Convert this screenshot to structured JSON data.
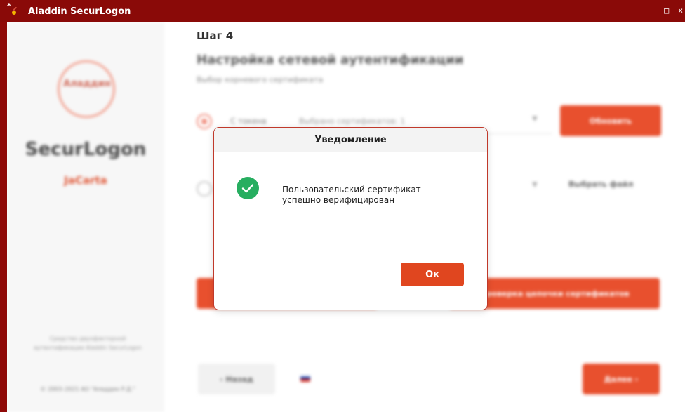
{
  "window": {
    "title": "Aladdin SecurLogon",
    "controls": {
      "minimize": "_",
      "maximize": "□",
      "close": "×"
    },
    "accent_color": "#8a0a08"
  },
  "sidebar": {
    "logo_text": "Аладдин",
    "brand": "SecurLogon",
    "brand_sub": "JaCarta",
    "note": "Средство двухфакторной аутентификации Aladdin SecurLogon",
    "copyright": "© 2003–2021 АО \"Аладдин Р.Д.\""
  },
  "main": {
    "step_label": "Шаг 4",
    "heading": "Настройка сетевой аутентификации",
    "subheading": "Выбор корневого сертификата",
    "option1_label": "С токена",
    "option1_select_value": "Выбрано сертификатов: 1",
    "update_button": "Обновить",
    "choose_file_button": "Выбрать файл",
    "chain_button": "Проверка цепочки сертификатов",
    "back_button": "‹  Назад",
    "next_button": "Далее  ›"
  },
  "dialog": {
    "title": "Уведомление",
    "message_line1": "Пользовательский сертификат",
    "message_line2": "успешно верифицирован",
    "ok_button": "Ок",
    "icon": "success-check-icon",
    "icon_color": "#27ae60",
    "button_color": "#e0461f"
  }
}
